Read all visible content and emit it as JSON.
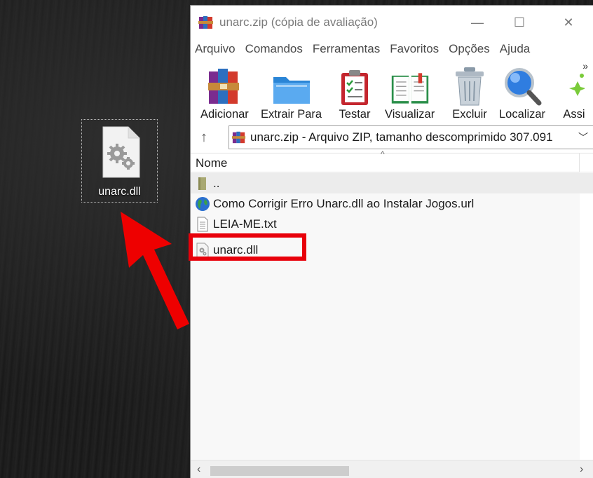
{
  "desktop": {
    "file_label": "unarc.dll"
  },
  "window": {
    "title": "unarc.zip (cópia de avaliação)",
    "controls": {
      "minimize": "—",
      "maximize": "☐",
      "close": "✕"
    }
  },
  "menu": [
    "Arquivo",
    "Comandos",
    "Ferramentas",
    "Favoritos",
    "Opções",
    "Ajuda"
  ],
  "toolbar": {
    "buttons": [
      {
        "label": "Adicionar",
        "icon": "books-add-icon"
      },
      {
        "label": "Extrair Para",
        "icon": "folder-extract-icon"
      },
      {
        "label": "Testar",
        "icon": "clipboard-test-icon"
      },
      {
        "label": "Visualizar",
        "icon": "book-view-icon"
      },
      {
        "label": "Excluir",
        "icon": "trash-icon"
      },
      {
        "label": "Localizar",
        "icon": "magnifier-icon"
      },
      {
        "label": "Assi",
        "icon": "wizard-icon"
      }
    ],
    "more": "»"
  },
  "address": {
    "up_icon": "↑",
    "text": "unarc.zip - Arquivo ZIP, tamanho descomprimido 307.091",
    "dropdown": "﹀"
  },
  "columns": {
    "name": "Nome",
    "sort_indicator": "^"
  },
  "files": [
    {
      "name": "..",
      "icon": "parent-folder-icon"
    },
    {
      "name": "Como Corrigir Erro Unarc.dll ao Instalar Jogos.url",
      "icon": "globe-icon"
    },
    {
      "name": "LEIA-ME.txt",
      "icon": "text-file-icon"
    },
    {
      "name": "unarc.dll",
      "icon": "dll-file-icon"
    }
  ],
  "scrollbar": {
    "left": "‹",
    "right": "›"
  },
  "colors": {
    "highlight": "#e8000a",
    "arrow": "#ee0000"
  }
}
